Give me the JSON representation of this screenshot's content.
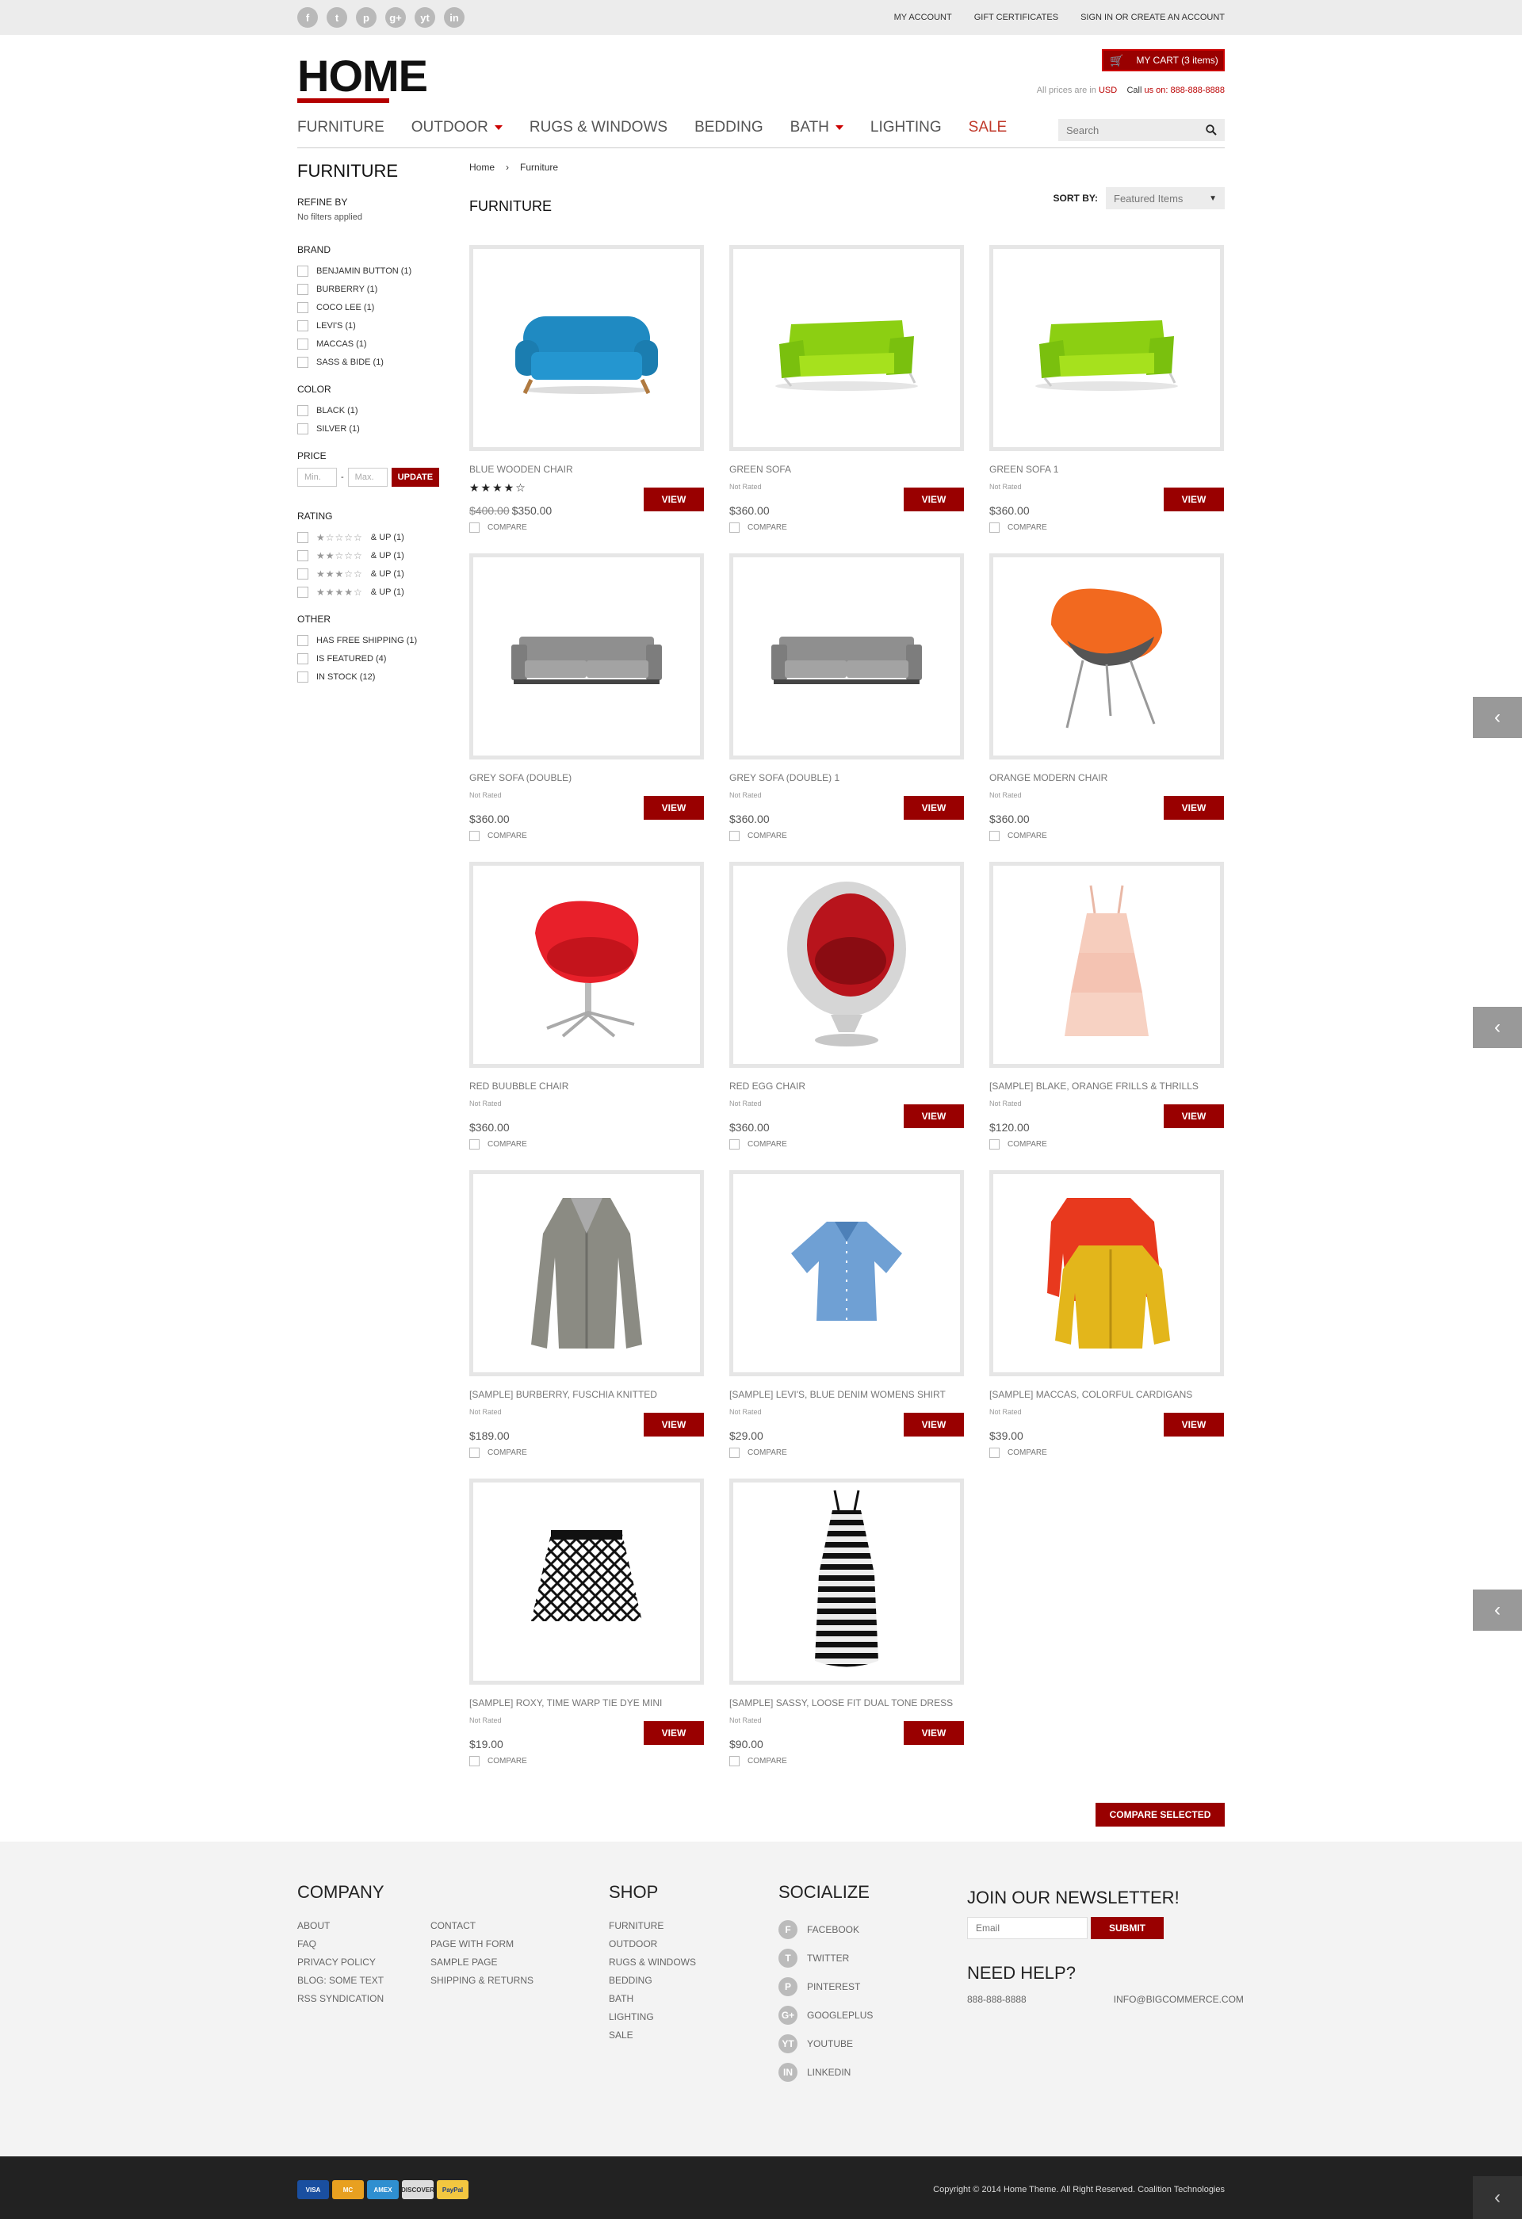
{
  "topbar": {
    "social": [
      "f",
      "t",
      "p",
      "g+",
      "yt",
      "in"
    ],
    "social_icons": [
      "facebook-icon",
      "twitter-icon",
      "pinterest-icon",
      "googleplus-icon",
      "youtube-icon",
      "linkedin-icon"
    ],
    "links": [
      "MY ACCOUNT",
      "GIFT CERTIFICATES",
      "SIGN IN OR CREATE AN ACCOUNT"
    ]
  },
  "header": {
    "logo": "HOME",
    "cart_label": "MY CART (3 items)",
    "prices_prefix": "All prices are in",
    "currency": "USD",
    "call_prefix": "Call",
    "call_us": "us on:",
    "phone": "888-888-8888"
  },
  "nav": {
    "items": [
      "FURNITURE",
      "OUTDOOR",
      "RUGS & WINDOWS",
      "BEDDING",
      "BATH",
      "LIGHTING",
      "SALE"
    ],
    "search_placeholder": "Search"
  },
  "sidebar": {
    "title": "FURNITURE",
    "refine_by": "REFINE BY",
    "no_filters": "No filters applied",
    "brand_h": "BRAND",
    "brands": [
      "BENJAMIN BUTTON (1)",
      "BURBERRY (1)",
      "COCO LEE (1)",
      "LEVI'S (1)",
      "MACCAS (1)",
      "SASS & BIDE (1)"
    ],
    "color_h": "COLOR",
    "colors": [
      "BLACK (1)",
      "SILVER (1)"
    ],
    "price_h": "PRICE",
    "min_placeholder": "Min.",
    "dash": "-",
    "max_placeholder": "Max.",
    "update": "UPDATE",
    "rating_h": "RATING",
    "ratings": [
      {
        "stars": "★☆☆☆☆",
        "label": "& UP (1)"
      },
      {
        "stars": "★★☆☆☆",
        "label": "& UP (1)"
      },
      {
        "stars": "★★★☆☆",
        "label": "& UP (1)"
      },
      {
        "stars": "★★★★☆",
        "label": "& UP (1)"
      }
    ],
    "other_h": "OTHER",
    "other": [
      "HAS FREE SHIPPING (1)",
      "IS FEATURED (4)",
      "IN STOCK (12)"
    ]
  },
  "main": {
    "breadcrumb": [
      "Home",
      "Furniture"
    ],
    "breadcrumb_sep": "›",
    "heading": "FURNITURE",
    "sort_label": "SORT BY:",
    "sort_value": "Featured Items",
    "view_label": "VIEW",
    "compare_label": "COMPARE",
    "compare_selected": "COMPARE SELECTED",
    "products": [
      {
        "name": "BLUE WOODEN CHAIR",
        "rating": "★★★★☆",
        "old_price": "$400.00",
        "price": "$350.00",
        "view": true,
        "img": "blue-sofa"
      },
      {
        "name": "GREEN SOFA",
        "rating": "Not Rated",
        "price": "$360.00",
        "view": true,
        "img": "green-sofa"
      },
      {
        "name": "GREEN SOFA 1",
        "rating": "Not Rated",
        "price": "$360.00",
        "view": true,
        "img": "green-sofa"
      },
      {
        "name": "GREY SOFA (DOUBLE)",
        "rating": "Not Rated",
        "price": "$360.00",
        "view": true,
        "img": "grey-sofa"
      },
      {
        "name": "GREY SOFA (DOUBLE) 1",
        "rating": "Not Rated",
        "price": "$360.00",
        "view": true,
        "img": "grey-sofa"
      },
      {
        "name": "ORANGE MODERN CHAIR",
        "rating": "Not Rated",
        "price": "$360.00",
        "view": true,
        "img": "orange-chair"
      },
      {
        "name": "RED BUUBBLE CHAIR",
        "rating": "Not Rated",
        "price": "$360.00",
        "view": false,
        "img": "red-chair"
      },
      {
        "name": "RED EGG CHAIR",
        "rating": "Not Rated",
        "price": "$360.00",
        "view": true,
        "img": "egg-chair"
      },
      {
        "name": "[SAMPLE] BLAKE, ORANGE FRILLS & THRILLS",
        "rating": "Not Rated",
        "price": "$120.00",
        "view": true,
        "img": "dress"
      },
      {
        "name": "[SAMPLE] BURBERRY, FUSCHIA KNITTED",
        "rating": "Not Rated",
        "price": "$189.00",
        "view": true,
        "img": "cardigan"
      },
      {
        "name": "[SAMPLE] LEVI'S, BLUE DENIM WOMENS SHIRT",
        "rating": "Not Rated",
        "price": "$29.00",
        "view": true,
        "img": "shirt"
      },
      {
        "name": "[SAMPLE] MACCAS, COLORFUL CARDIGANS",
        "rating": "Not Rated",
        "price": "$39.00",
        "view": true,
        "img": "cardigans"
      },
      {
        "name": "[SAMPLE] ROXY, TIME WARP TIE DYE MINI",
        "rating": "Not Rated",
        "price": "$19.00",
        "view": true,
        "img": "skirt"
      },
      {
        "name": "[SAMPLE] SASSY, LOOSE FIT DUAL TONE DRESS",
        "rating": "Not Rated",
        "price": "$90.00",
        "view": true,
        "img": "stripe-dress"
      }
    ]
  },
  "footer": {
    "company_h": "COMPANY",
    "company_col1": [
      "ABOUT",
      "FAQ",
      "PRIVACY POLICY",
      "BLOG: SOME TEXT",
      "RSS SYNDICATION"
    ],
    "company_col2": [
      "CONTACT",
      "PAGE WITH FORM",
      "SAMPLE PAGE",
      "SHIPPING & RETURNS"
    ],
    "shop_h": "SHOP",
    "shop": [
      "FURNITURE",
      "OUTDOOR",
      "RUGS & WINDOWS",
      "BEDDING",
      "BATH",
      "LIGHTING",
      "SALE"
    ],
    "socialize_h": "SOCIALIZE",
    "socialize": [
      {
        "glyph": "f",
        "label": "FACEBOOK"
      },
      {
        "glyph": "t",
        "label": "TWITTER"
      },
      {
        "glyph": "p",
        "label": "PINTEREST"
      },
      {
        "glyph": "g+",
        "label": "GOOGLEPLUS"
      },
      {
        "glyph": "yt",
        "label": "YOUTUBE"
      },
      {
        "glyph": "in",
        "label": "LINKEDIN"
      }
    ],
    "newsletter_h": "JOIN OUR NEWSLETTER!",
    "email_placeholder": "Email",
    "submit": "SUBMIT",
    "help_h": "NEED HELP?",
    "help_phone": "888-888-8888",
    "help_email": "INFO@BIGCOMMERCE.COM",
    "payments": [
      "VISA",
      "MC",
      "AMEX",
      "DISCOVER",
      "PayPal"
    ],
    "copyright": "Copyright © 2014 Home Theme. All Right Reserved. Coalition Technologies"
  },
  "colors": {
    "accent": "#990000",
    "sale": "#c0392b",
    "topbar": "#ececec",
    "footer": "#f3f3f3",
    "bottom": "#222222"
  }
}
